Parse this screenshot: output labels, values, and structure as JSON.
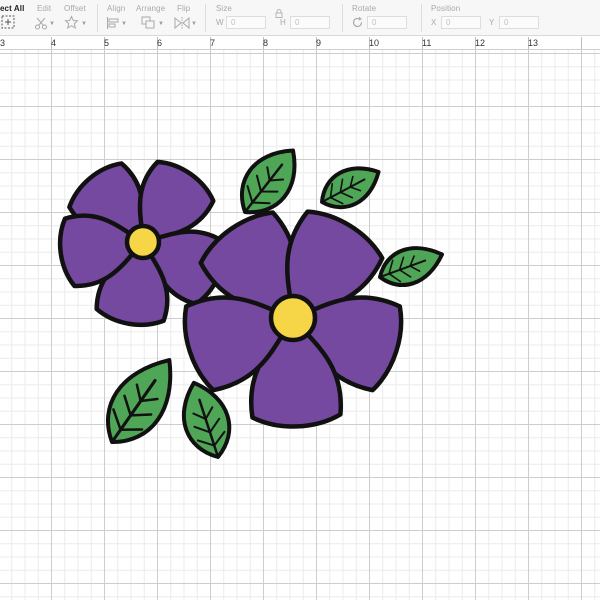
{
  "toolbar": {
    "select_all_label": "ect All",
    "edit_label": "Edit",
    "offset_label": "Offset",
    "align_label": "Align",
    "arrange_label": "Arrange",
    "flip_label": "Flip",
    "size_label": "Size",
    "width_label": "W",
    "width_value": "0",
    "height_label": "H",
    "height_value": "0",
    "rotate_label": "Rotate",
    "rotate_value": "0",
    "position_label": "Position",
    "x_label": "X",
    "x_value": "0",
    "y_label": "Y",
    "y_value": "0"
  },
  "ruler": {
    "numbers": [
      "3",
      "4",
      "5",
      "6",
      "7",
      "8",
      "9",
      "10",
      "11",
      "12",
      "13"
    ]
  },
  "canvas": {
    "image_name": "purple-flowers-with-green-leaves",
    "colors": {
      "petal": "#7549a0",
      "center": "#f6d546",
      "leaf": "#4fa657",
      "outline": "#111111",
      "grid_major": "#cdcdcd",
      "grid_minor": "#ebebeb"
    }
  }
}
